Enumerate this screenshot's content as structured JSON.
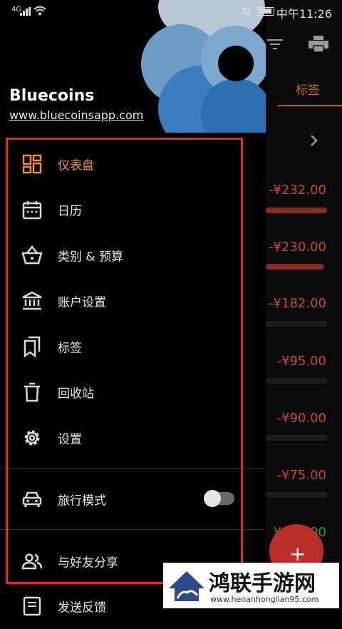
{
  "status_bar": {
    "network": "4G",
    "time": "中午11:26"
  },
  "app": {
    "name": "Bluecoins",
    "website": "www.bluecoinsapp.com"
  },
  "menu": {
    "items": [
      {
        "label": "仪表盘"
      },
      {
        "label": "日历"
      },
      {
        "label": "类别 & 预算"
      },
      {
        "label": "账户设置"
      },
      {
        "label": "标签"
      },
      {
        "label": "回收站"
      },
      {
        "label": "设置"
      }
    ],
    "travel_mode": {
      "label": "旅行模式",
      "enabled": false
    },
    "share": {
      "label": "与好友分享"
    },
    "feedback": {
      "label": "发送反馈"
    }
  },
  "background": {
    "tab_label": "标签",
    "amounts": [
      "-¥232.00",
      "-¥230.00",
      "-¥182.00",
      "-¥95.00",
      "-¥90.00",
      "-¥75.00",
      "¥680.00"
    ],
    "fab_label": "+"
  },
  "watermark": {
    "title": "鸿联手游网",
    "url": "www.henanhonglian95.com"
  },
  "colors": {
    "accent": "#f28f35",
    "highlight_frame": "#e02c1f",
    "expense": "#c8463c",
    "income": "#3a8a3a"
  }
}
